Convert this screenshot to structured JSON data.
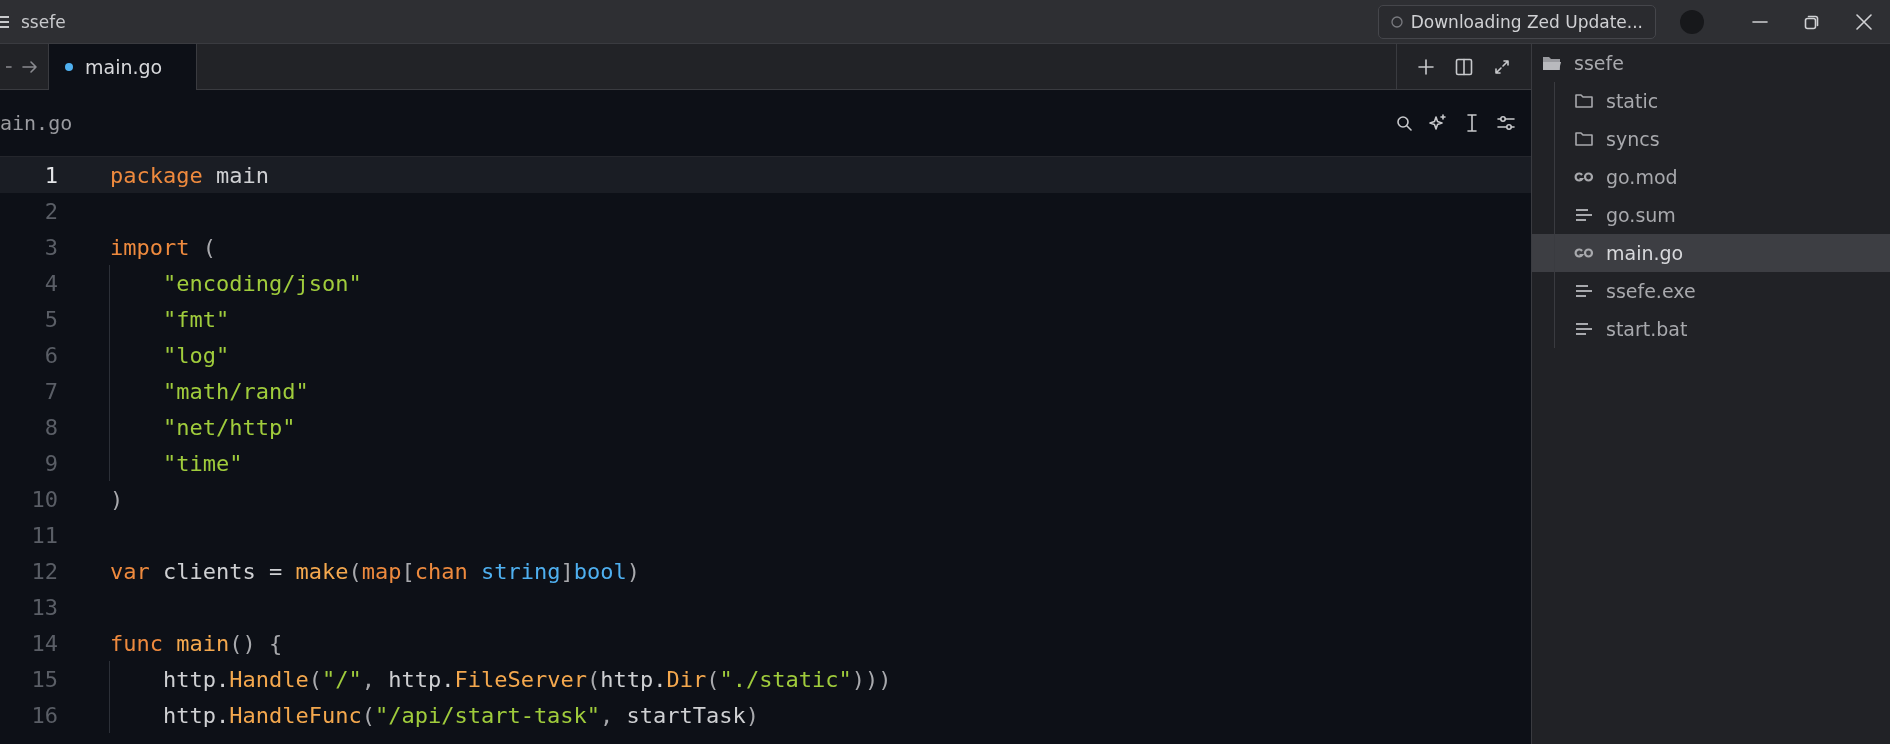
{
  "window": {
    "title": "ssefe",
    "update_status": "Downloading Zed Update..."
  },
  "tabs": [
    {
      "label": "main.go",
      "selected": true,
      "modified": true
    }
  ],
  "breadcrumb": "ain.go",
  "editor": {
    "lines": [
      {
        "number": "1",
        "current": true,
        "indented": false,
        "tokens": [
          {
            "kind": "keyword",
            "text": "package"
          },
          {
            "kind": "plain",
            "text": " main"
          }
        ]
      },
      {
        "number": "2",
        "current": false,
        "indented": false
      },
      {
        "number": "3",
        "current": false,
        "indented": false,
        "tokens": [
          {
            "kind": "keyword",
            "text": "import"
          },
          {
            "kind": "punct",
            "text": " ("
          }
        ]
      },
      {
        "number": "4",
        "current": false,
        "indented": true,
        "tokens": [
          {
            "kind": "string",
            "text": "\"encoding/json\""
          }
        ]
      },
      {
        "number": "5",
        "current": false,
        "indented": true,
        "tokens": [
          {
            "kind": "string",
            "text": "\"fmt\""
          }
        ]
      },
      {
        "number": "6",
        "current": false,
        "indented": true,
        "tokens": [
          {
            "kind": "string",
            "text": "\"log\""
          }
        ]
      },
      {
        "number": "7",
        "current": false,
        "indented": true,
        "tokens": [
          {
            "kind": "string",
            "text": "\"math/rand\""
          }
        ]
      },
      {
        "number": "8",
        "current": false,
        "indented": true,
        "tokens": [
          {
            "kind": "string",
            "text": "\"net/http\""
          }
        ]
      },
      {
        "number": "9",
        "current": false,
        "indented": true,
        "tokens": [
          {
            "kind": "string",
            "text": "\"time\""
          }
        ]
      },
      {
        "number": "10",
        "current": false,
        "indented": false,
        "tokens": [
          {
            "kind": "punct",
            "text": ")"
          }
        ]
      },
      {
        "number": "11",
        "current": false,
        "indented": false
      },
      {
        "number": "12",
        "current": false,
        "indented": false,
        "tokens": [
          {
            "kind": "keyword",
            "text": "var"
          },
          {
            "kind": "plain",
            "text": " clients = "
          },
          {
            "kind": "function",
            "text": "make"
          },
          {
            "kind": "punct",
            "text": "("
          },
          {
            "kind": "keyword",
            "text": "map"
          },
          {
            "kind": "punct",
            "text": "["
          },
          {
            "kind": "keyword",
            "text": "chan"
          },
          {
            "kind": "type",
            "text": " string"
          },
          {
            "kind": "punct",
            "text": "]"
          },
          {
            "kind": "type",
            "text": "bool"
          },
          {
            "kind": "punct",
            "text": ")"
          }
        ]
      },
      {
        "number": "13",
        "current": false,
        "indented": false
      },
      {
        "number": "14",
        "current": false,
        "indented": false,
        "tokens": [
          {
            "kind": "keyword",
            "text": "func"
          },
          {
            "kind": "function",
            "text": " main"
          },
          {
            "kind": "punct",
            "text": "() {"
          }
        ]
      },
      {
        "number": "15",
        "current": false,
        "indented": true,
        "tokens": [
          {
            "kind": "plain",
            "text": "http."
          },
          {
            "kind": "function",
            "text": "Handle"
          },
          {
            "kind": "punct",
            "text": "("
          },
          {
            "kind": "string",
            "text": "\"/\""
          },
          {
            "kind": "punct",
            "text": ", "
          },
          {
            "kind": "plain",
            "text": "http."
          },
          {
            "kind": "function",
            "text": "FileServer"
          },
          {
            "kind": "punct",
            "text": "("
          },
          {
            "kind": "plain",
            "text": "http."
          },
          {
            "kind": "function",
            "text": "Dir"
          },
          {
            "kind": "punct",
            "text": "("
          },
          {
            "kind": "string",
            "text": "\"./static\""
          },
          {
            "kind": "punct",
            "text": ")))"
          }
        ]
      },
      {
        "number": "16",
        "current": false,
        "indented": true,
        "tokens": [
          {
            "kind": "plain",
            "text": "http."
          },
          {
            "kind": "function",
            "text": "HandleFunc"
          },
          {
            "kind": "punct",
            "text": "("
          },
          {
            "kind": "string",
            "text": "\"/api/start-task\""
          },
          {
            "kind": "punct",
            "text": ", "
          },
          {
            "kind": "plain",
            "text": "startTask"
          },
          {
            "kind": "punct",
            "text": ")"
          }
        ]
      }
    ]
  },
  "project_panel": {
    "root": {
      "label": "ssefe",
      "kind": "folder",
      "expanded": true,
      "selected": false,
      "children": [
        {
          "label": "static",
          "kind": "folder",
          "expanded": false,
          "selected": false
        },
        {
          "label": "syncs",
          "kind": "folder",
          "expanded": false,
          "selected": false
        },
        {
          "label": "go.mod",
          "kind": "go",
          "selected": false
        },
        {
          "label": "go.sum",
          "kind": "text",
          "selected": false
        },
        {
          "label": "main.go",
          "kind": "go",
          "selected": true
        },
        {
          "label": "ssefe.exe",
          "kind": "text",
          "selected": false
        },
        {
          "label": "start.bat",
          "kind": "text",
          "selected": false
        }
      ]
    }
  }
}
